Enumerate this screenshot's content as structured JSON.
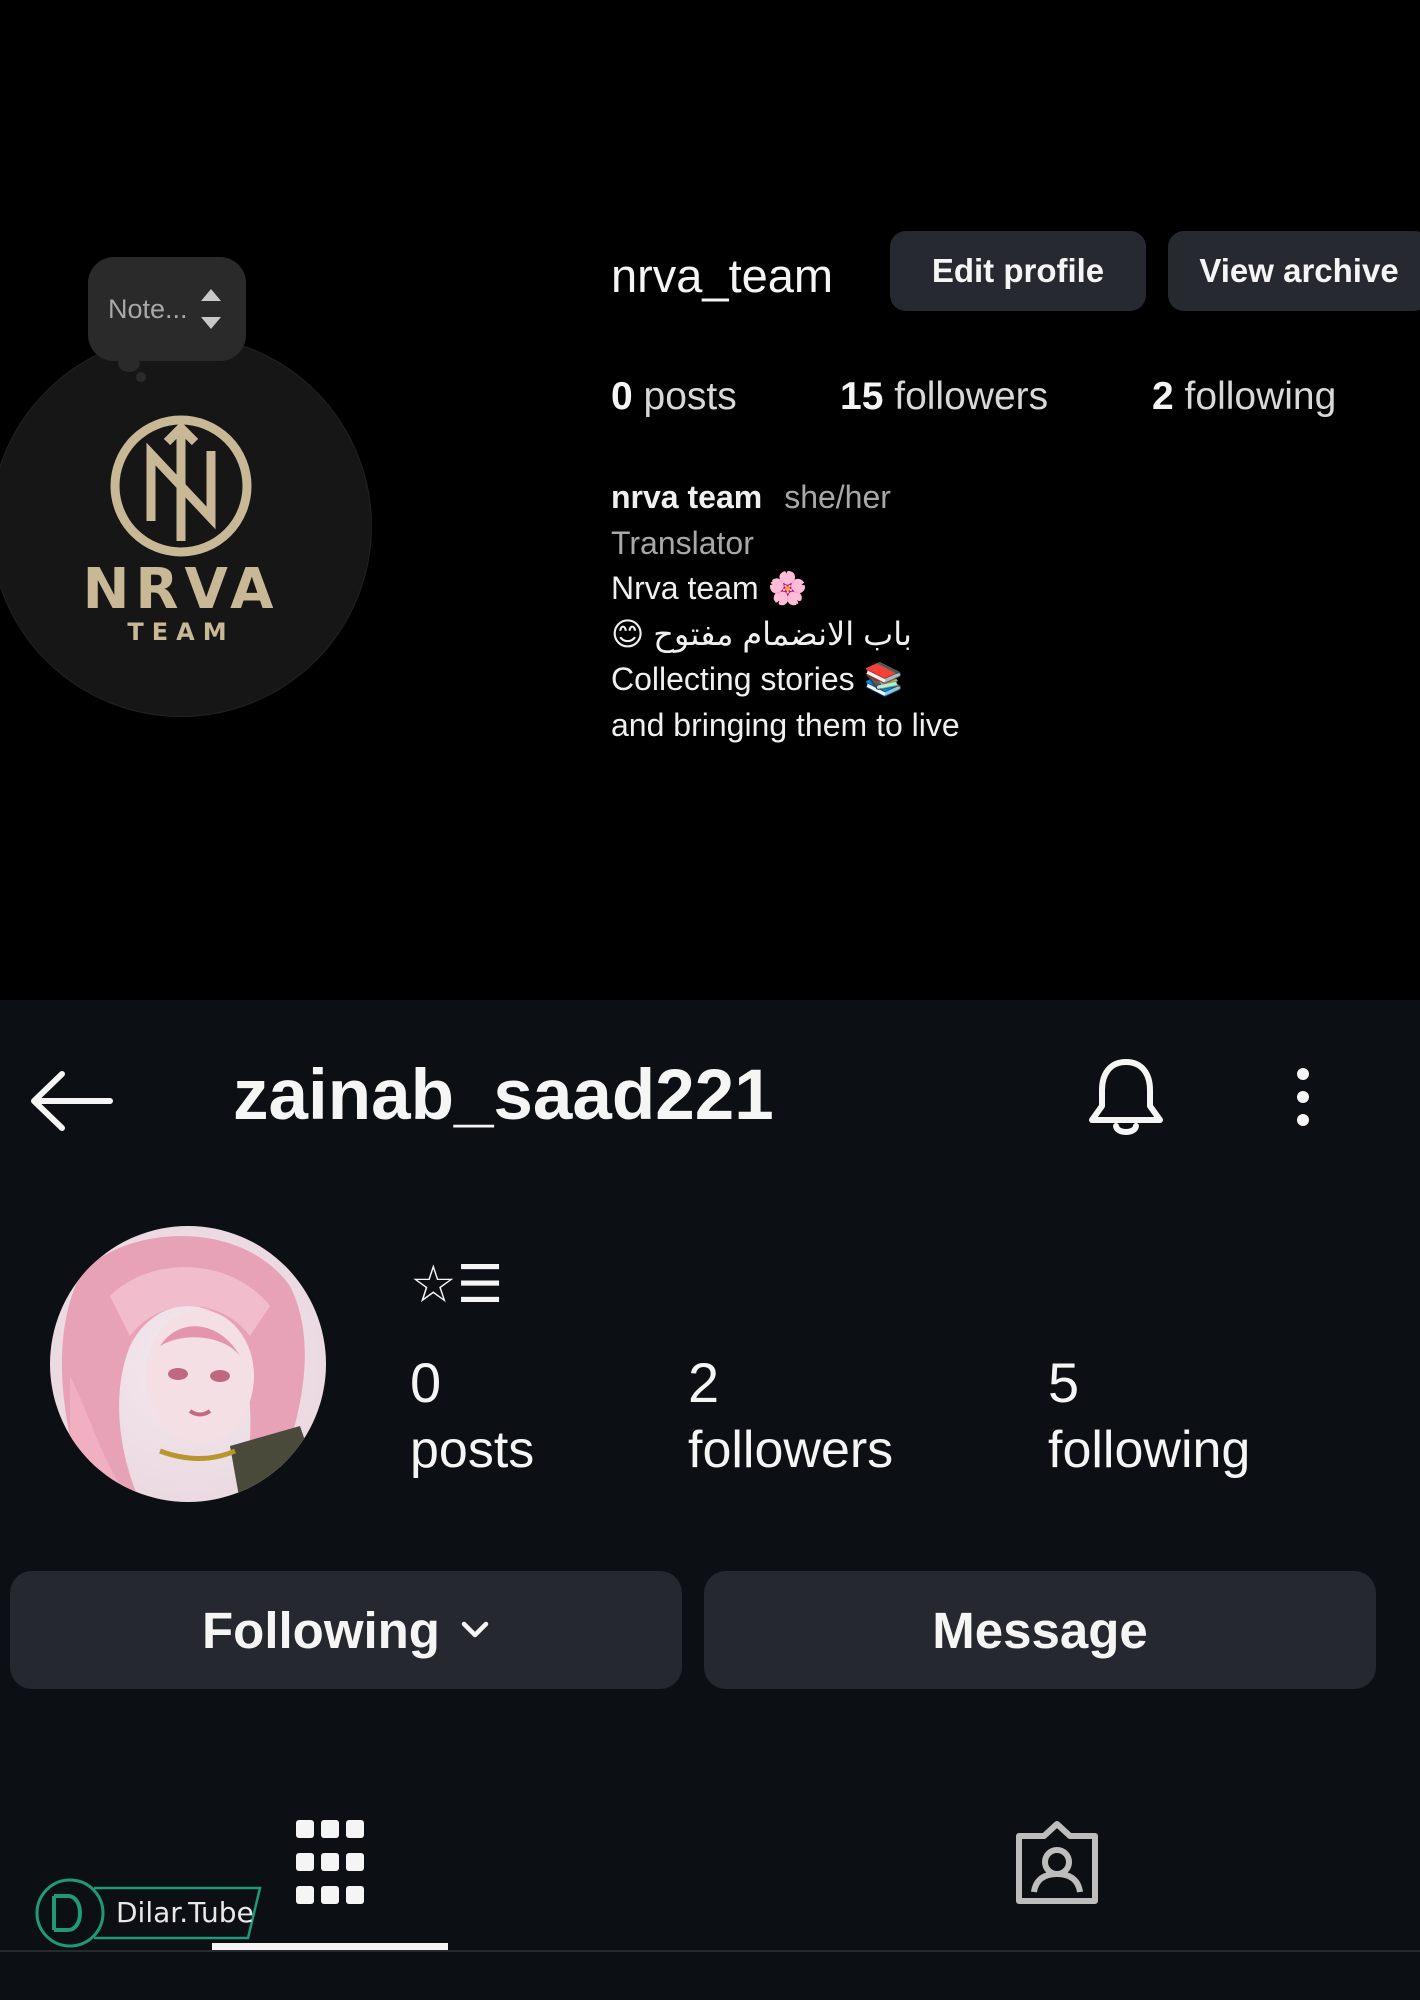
{
  "desktop_profile": {
    "note_placeholder": "Note...",
    "logo": {
      "brand": "NRVA",
      "subtitle": "TEAM"
    },
    "username": "nrva_team",
    "buttons": {
      "edit": "Edit profile",
      "archive": "View archive"
    },
    "stats": [
      {
        "count": "0",
        "label": "posts"
      },
      {
        "count": "15",
        "label": "followers"
      },
      {
        "count": "2",
        "label": "following"
      }
    ],
    "bio": {
      "name": "nrva team",
      "pronouns": "she/her",
      "category": "Translator",
      "line1": "Nrva team 🌸",
      "line2": "باب الانضمام مفتوح 😊",
      "line3": "Collecting stories 📚",
      "line4": "and bringing them to live"
    }
  },
  "mobile_profile": {
    "username": "zainab_saad221",
    "badge": "☆☰",
    "stats": [
      {
        "count": "0",
        "label": "posts"
      },
      {
        "count": "2",
        "label": "followers"
      },
      {
        "count": "5",
        "label": "following"
      }
    ],
    "buttons": {
      "following": "Following",
      "message": "Message"
    },
    "tabs": {
      "active": "grid"
    },
    "watermark": "Dilar.Tube"
  },
  "colors": {
    "desktop_bg": "#000000",
    "mobile_bg": "#0c1014",
    "button_bg": "#25292f",
    "logo_gold": "#c9b895"
  },
  "icons": [
    "back-arrow-icon",
    "bell-icon",
    "more-vertical-icon",
    "grid-icon",
    "tagged-icon",
    "chevron-down-icon"
  ]
}
